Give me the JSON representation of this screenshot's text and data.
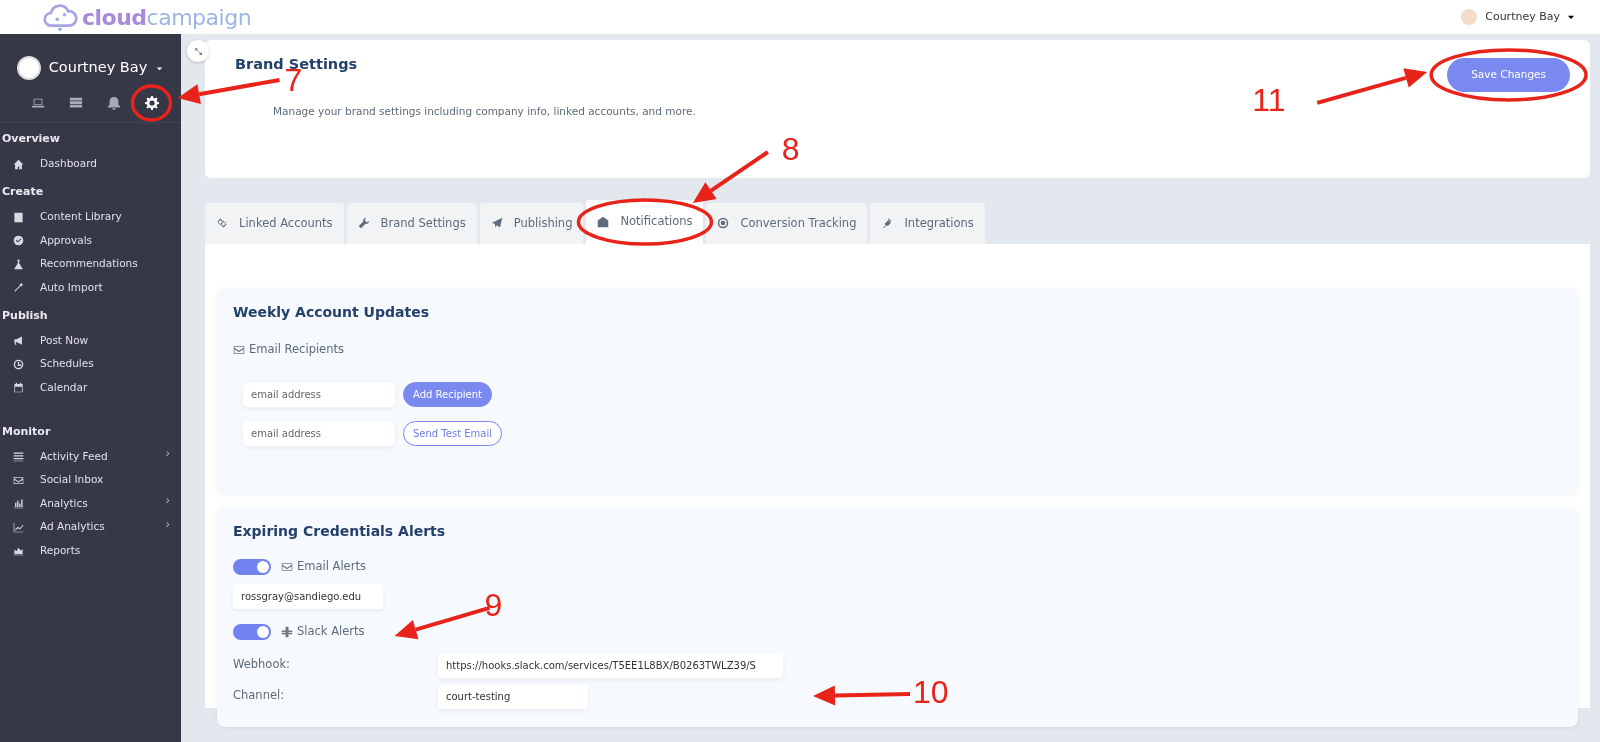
{
  "topbar": {
    "logo": "**cloud**campaign",
    "user": "Courtney Bay"
  },
  "sidebar": {
    "user": "Courtney Bay",
    "sections": [
      {
        "title": "Overview",
        "items": [
          {
            "label": "Dashboard",
            "has_submenu": false
          }
        ]
      },
      {
        "title": "Create",
        "items": [
          {
            "label": "Content Library",
            "has_submenu": false
          },
          {
            "label": "Approvals",
            "has_submenu": false
          },
          {
            "label": "Recommendations",
            "has_submenu": false
          },
          {
            "label": "Auto Import",
            "has_submenu": false
          }
        ]
      },
      {
        "title": "Publish",
        "items": [
          {
            "label": "Post Now",
            "has_submenu": false
          },
          {
            "label": "Schedules",
            "has_submenu": false
          },
          {
            "label": "Calendar",
            "has_submenu": false
          }
        ]
      },
      {
        "title": "Monitor",
        "items": [
          {
            "label": "Activity Feed",
            "has_submenu": true
          },
          {
            "label": "Social Inbox",
            "has_submenu": false
          },
          {
            "label": "Analytics",
            "has_submenu": true
          },
          {
            "label": "Ad Analytics",
            "has_submenu": true
          },
          {
            "label": "Reports",
            "has_submenu": false
          }
        ]
      }
    ]
  },
  "header": {
    "title": "Brand Settings",
    "description": "Manage your brand settings including company info, linked accounts, and more.",
    "save_button": "Save Changes"
  },
  "tabs": [
    {
      "label": "Linked Accounts",
      "selected": false
    },
    {
      "label": "Brand Settings",
      "selected": false
    },
    {
      "label": "Publishing",
      "selected": false
    },
    {
      "label": "Notifications",
      "selected": true
    },
    {
      "label": "Conversion Tracking",
      "selected": false
    },
    {
      "label": "Integrations",
      "selected": false
    }
  ],
  "weekly": {
    "title": "Weekly Account Updates",
    "recipients_label": "Email Recipients",
    "rows": [
      {
        "placeholder": "email address",
        "button": "Add Recipient",
        "kind": "filled"
      },
      {
        "placeholder": "email address",
        "button": "Send Test Email",
        "kind": "outline"
      }
    ]
  },
  "alerts": {
    "title": "Expiring Credentials Alerts",
    "email": {
      "label": "Email Alerts",
      "on": true,
      "value": "rossgray@sandiego.edu"
    },
    "slack": {
      "label": "Slack Alerts",
      "on": true
    },
    "fields": [
      {
        "label": "Webhook:",
        "value": "https://hooks.slack.com/services/T5EE1L8BX/B0263TWLZ39/S"
      },
      {
        "label": "Channel:",
        "value": "court-testing"
      }
    ]
  },
  "annotations": [
    {
      "label": "7"
    },
    {
      "label": "8"
    },
    {
      "label": "9"
    },
    {
      "label": "10"
    },
    {
      "label": "11"
    }
  ]
}
